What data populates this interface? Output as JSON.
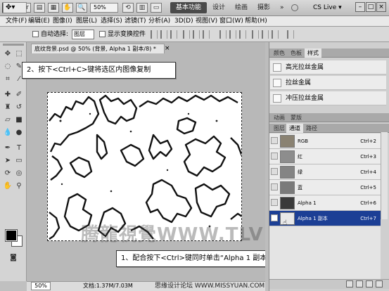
{
  "app": {
    "logo": "Ps",
    "zoom": "50%",
    "ws_essentials": "基本功能",
    "ws_design": "设计",
    "ws_paint": "绘画",
    "ws_photo": "摄影",
    "ws_more": "»",
    "cslive": "CS Live ▾",
    "win_min": "–",
    "win_max": "□",
    "win_close": "×"
  },
  "menu": [
    "文件(F)",
    "编辑(E)",
    "图像(I)",
    "图层(L)",
    "选择(S)",
    "滤镜(T)",
    "分析(A)",
    "3D(D)",
    "视图(V)",
    "窗口(W)",
    "帮助(H)"
  ],
  "options": {
    "auto_select_label": "自动选择:",
    "auto_select_value": "图层",
    "show_transform_label": "显示变换控件"
  },
  "document": {
    "tab_title": "底纹背景.psd @ 50% (背景, Alpha 1 副本/8) *",
    "close": "×",
    "zoom_status": "50%",
    "doc_size": "文档:1.37M/7.03M"
  },
  "callouts": {
    "step2": "2、按下<Ctrl+C>键将选区内图像复制",
    "step1": "1、配合按下<Ctrl>键同时单击“Alpha 1 副本”通道缩览图"
  },
  "watermark": "腾龍視覺WWW.TLVI.NET",
  "footer_credit": "思缘设计论坛 WWW.MISSYUAN.COM",
  "styles_panel": {
    "tabs": [
      "颜色",
      "色板",
      "样式"
    ],
    "items": [
      "高光拉丝金属",
      "拉丝金属",
      "冲压拉丝金属"
    ]
  },
  "mini_panel": {
    "tabs": [
      "动画",
      "蒙版"
    ]
  },
  "channels_panel": {
    "tabs": [
      "图层",
      "通道",
      "路径"
    ],
    "rows": [
      {
        "name": "RGB",
        "key": "Ctrl+2"
      },
      {
        "name": "红",
        "key": "Ctrl+3"
      },
      {
        "name": "绿",
        "key": "Ctrl+4"
      },
      {
        "name": "蓝",
        "key": "Ctrl+5"
      },
      {
        "name": "Alpha 1",
        "key": "Ctrl+6"
      },
      {
        "name": "Alpha 1 副本",
        "key": "Ctrl+7"
      }
    ]
  }
}
